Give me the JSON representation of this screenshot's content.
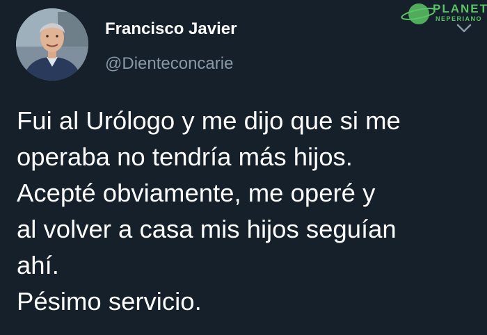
{
  "author": {
    "name": "Francisco Javier",
    "handle": "@Dienteconcarie"
  },
  "tweet": {
    "lines": [
      "Fui al Urólogo y me dijo que si me",
      "operaba no tendría más hijos.",
      "Acepté obviamente, me operé y",
      "al volver a casa mis hijos seguían",
      "ahí.",
      "Pésimo servicio."
    ]
  },
  "watermark": {
    "line1": "PLANETA",
    "line2": "NEPERIANO"
  },
  "colors": {
    "background": "#15202b",
    "text_primary": "#ffffff",
    "text_secondary": "#8899a6",
    "watermark": "#5ac466"
  },
  "icons": {
    "more": "chevron-down-icon",
    "watermark_logo": "planet-icon"
  }
}
